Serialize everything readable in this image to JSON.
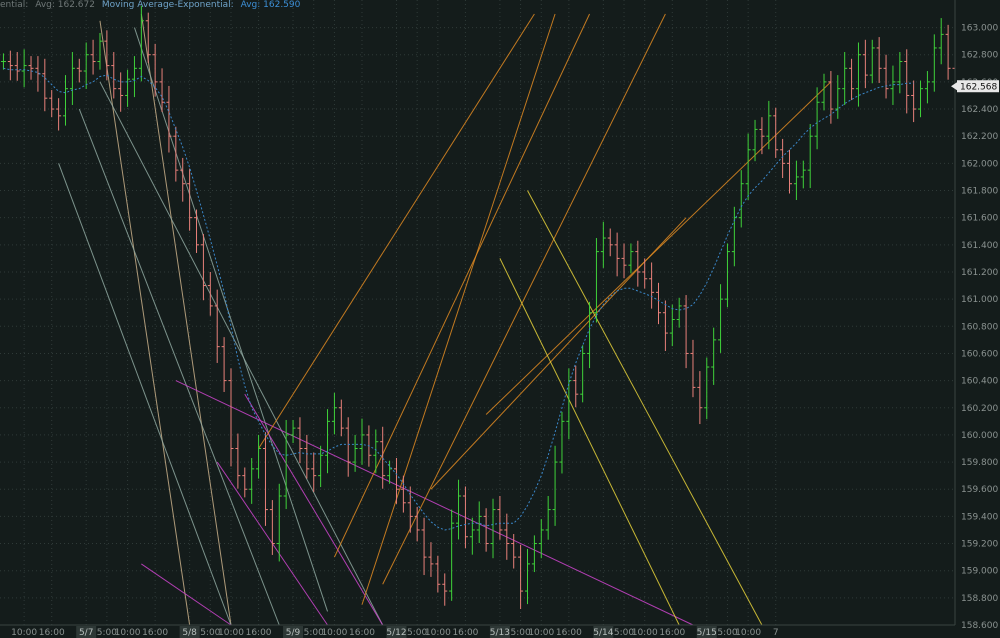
{
  "header": {
    "study1": "ential:",
    "avg1": "Avg: 162.672",
    "study2": "Moving Average-Exponential:",
    "avg2": "Avg: 162.590"
  },
  "chart_data": {
    "type": "candlestick",
    "ylim": [
      158.6,
      163.1
    ],
    "last_price": "162.568",
    "y_ticks": [
      "163.000",
      "162.800",
      "162.600",
      "162.400",
      "162.200",
      "162.000",
      "161.800",
      "161.600",
      "161.400",
      "161.200",
      "161.000",
      "160.800",
      "160.600",
      "160.400",
      "160.200",
      "160.000",
      "159.800",
      "159.600",
      "159.400",
      "159.200",
      "159.000",
      "158.800",
      "158.600"
    ],
    "x_ticks": [
      {
        "i": 3,
        "label": "10:00",
        "day": false
      },
      {
        "i": 7,
        "label": "16:00",
        "day": false
      },
      {
        "i": 12,
        "label": "5/7",
        "day": true
      },
      {
        "i": 15,
        "label": "5:00",
        "day": false
      },
      {
        "i": 18,
        "label": "10:00",
        "day": false
      },
      {
        "i": 22,
        "label": "16:00",
        "day": false
      },
      {
        "i": 27,
        "label": "5/8",
        "day": true
      },
      {
        "i": 30,
        "label": "5:00",
        "day": false
      },
      {
        "i": 33,
        "label": "10:00",
        "day": false
      },
      {
        "i": 37,
        "label": "16:00",
        "day": false
      },
      {
        "i": 42,
        "label": "5/9",
        "day": true
      },
      {
        "i": 45,
        "label": "5:00",
        "day": false
      },
      {
        "i": 48,
        "label": "10:00",
        "day": false
      },
      {
        "i": 52,
        "label": "16:00",
        "day": false
      },
      {
        "i": 57,
        "label": "5/12",
        "day": true
      },
      {
        "i": 60,
        "label": "5:00",
        "day": false
      },
      {
        "i": 63,
        "label": "10:00",
        "day": false
      },
      {
        "i": 67,
        "label": "16:00",
        "day": false
      },
      {
        "i": 72,
        "label": "5/13",
        "day": true
      },
      {
        "i": 75,
        "label": "5:00",
        "day": false
      },
      {
        "i": 78,
        "label": "10:00",
        "day": false
      },
      {
        "i": 82,
        "label": "16:00",
        "day": false
      },
      {
        "i": 87,
        "label": "5/14",
        "day": true
      },
      {
        "i": 90,
        "label": "5:00",
        "day": false
      },
      {
        "i": 93,
        "label": "10:00",
        "day": false
      },
      {
        "i": 97,
        "label": "16:00",
        "day": false
      },
      {
        "i": 102,
        "label": "5/15",
        "day": true
      },
      {
        "i": 105,
        "label": "5:00",
        "day": false
      },
      {
        "i": 108,
        "label": "10:00",
        "day": false
      },
      {
        "i": 112,
        "label": "7",
        "day": false
      }
    ],
    "close": [
      162.75,
      162.72,
      162.68,
      162.72,
      162.7,
      162.66,
      162.48,
      162.4,
      162.35,
      162.55,
      162.7,
      162.68,
      162.8,
      162.75,
      162.9,
      162.72,
      162.55,
      162.5,
      162.62,
      162.7,
      163.05,
      162.8,
      162.6,
      162.45,
      162.2,
      161.95,
      161.85,
      161.6,
      161.4,
      161.1,
      160.95,
      160.65,
      160.4,
      159.9,
      159.7,
      159.6,
      159.75,
      159.9,
      159.45,
      159.2,
      159.55,
      160.0,
      160.05,
      159.9,
      159.75,
      159.7,
      159.85,
      160.1,
      160.2,
      160.05,
      159.8,
      159.9,
      160.0,
      159.85,
      159.95,
      159.7,
      159.75,
      159.6,
      159.5,
      159.4,
      159.3,
      159.1,
      159.05,
      158.9,
      158.85,
      159.35,
      159.55,
      159.25,
      159.3,
      159.4,
      159.2,
      159.45,
      159.3,
      159.2,
      159.1,
      158.85,
      159.05,
      159.2,
      159.3,
      159.45,
      159.8,
      160.1,
      160.4,
      160.3,
      160.6,
      160.9,
      161.35,
      161.45,
      161.4,
      161.3,
      161.25,
      161.35,
      161.2,
      161.15,
      161.05,
      160.9,
      160.75,
      160.85,
      160.95,
      160.6,
      160.35,
      160.2,
      160.5,
      160.7,
      161.0,
      161.35,
      161.6,
      161.85,
      162.1,
      162.25,
      162.2,
      162.35,
      162.1,
      162.0,
      161.85,
      161.9,
      161.95,
      162.2,
      162.45,
      162.6,
      162.4,
      162.55,
      162.7,
      162.55,
      162.8,
      162.65,
      162.85,
      162.7,
      162.55,
      162.6,
      162.75,
      162.5,
      162.4,
      162.55,
      162.6,
      162.85,
      162.95,
      162.7,
      162.55
    ],
    "ema": [
      162.7,
      162.69,
      162.69,
      162.69,
      162.68,
      162.67,
      162.63,
      162.58,
      162.53,
      162.52,
      162.54,
      162.55,
      162.58,
      162.6,
      162.64,
      162.65,
      162.62,
      162.6,
      162.6,
      162.61,
      162.64,
      162.61,
      162.56,
      162.49,
      162.38,
      162.25,
      162.12,
      161.97,
      161.8,
      161.62,
      161.44,
      161.25,
      161.05,
      160.8,
      160.56,
      160.36,
      160.2,
      160.1,
      160.0,
      159.92,
      159.86,
      159.85,
      159.86,
      159.87,
      159.86,
      159.86,
      159.86,
      159.88,
      159.91,
      159.93,
      159.93,
      159.93,
      159.93,
      159.92,
      159.89,
      159.83,
      159.77,
      159.71,
      159.64,
      159.56,
      159.49,
      159.42,
      159.36,
      159.32,
      159.3,
      159.31,
      159.33,
      159.34,
      159.35,
      159.35,
      159.33,
      159.34,
      159.35,
      159.35,
      159.35,
      159.4,
      159.48,
      159.58,
      159.7,
      159.85,
      160.02,
      160.2,
      160.38,
      160.53,
      160.66,
      160.78,
      160.88,
      160.96,
      161.02,
      161.06,
      161.08,
      161.08,
      161.06,
      161.04,
      161.02,
      160.99,
      160.96,
      160.93,
      160.92,
      160.93,
      160.96,
      161.03,
      161.12,
      161.23,
      161.35,
      161.47,
      161.58,
      161.68,
      161.76,
      161.82,
      161.87,
      161.93,
      161.99,
      162.05,
      162.1,
      162.15,
      162.21,
      162.26,
      162.3,
      162.33,
      162.36,
      162.4,
      162.44,
      162.47,
      162.5,
      162.52,
      162.54,
      162.56,
      162.57,
      162.58,
      162.58,
      162.59,
      162.59
    ],
    "trendlines": [
      {
        "color": "#c9b08a",
        "x1": 14,
        "y1": 163.05,
        "x2": 27,
        "y2": 158.6
      },
      {
        "color": "#c9b08a",
        "x1": 20,
        "y1": 163.1,
        "x2": 33,
        "y2": 158.6
      },
      {
        "color": "#8fa8a0",
        "x1": 8,
        "y1": 162.0,
        "x2": 33,
        "y2": 158.6
      },
      {
        "color": "#8fa8a0",
        "x1": 11,
        "y1": 162.4,
        "x2": 40,
        "y2": 158.6
      },
      {
        "color": "#8fa8a0",
        "x1": 14,
        "y1": 162.6,
        "x2": 55,
        "y2": 158.6
      },
      {
        "color": "#8fa8a0",
        "x1": 19,
        "y1": 163.0,
        "x2": 47,
        "y2": 158.7
      },
      {
        "color": "#cc44cc",
        "x1": 25,
        "y1": 160.4,
        "x2": 100,
        "y2": 158.6
      },
      {
        "color": "#cc44cc",
        "x1": 31,
        "y1": 159.8,
        "x2": 47,
        "y2": 158.6
      },
      {
        "color": "#cc44cc",
        "x1": 20,
        "y1": 159.05,
        "x2": 33,
        "y2": 158.6
      },
      {
        "color": "#cc44cc",
        "x1": 35,
        "y1": 160.3,
        "x2": 55,
        "y2": 158.6
      },
      {
        "color": "#e08a22",
        "x1": 52,
        "y1": 158.75,
        "x2": 80,
        "y2": 163.1
      },
      {
        "color": "#e08a22",
        "x1": 48,
        "y1": 159.1,
        "x2": 85,
        "y2": 163.1
      },
      {
        "color": "#e08a22",
        "x1": 37,
        "y1": 159.9,
        "x2": 77,
        "y2": 163.1
      },
      {
        "color": "#e08a22",
        "x1": 55,
        "y1": 158.9,
        "x2": 96,
        "y2": 163.1
      },
      {
        "color": "#e08a22",
        "x1": 70,
        "y1": 160.15,
        "x2": 120,
        "y2": 162.6
      },
      {
        "color": "#e08a22",
        "x1": 62,
        "y1": 159.6,
        "x2": 99,
        "y2": 161.6
      },
      {
        "color": "#e6d23a",
        "x1": 76,
        "y1": 161.8,
        "x2": 110,
        "y2": 158.6
      },
      {
        "color": "#e6d23a",
        "x1": 72,
        "y1": 161.3,
        "x2": 98,
        "y2": 158.6
      }
    ]
  }
}
